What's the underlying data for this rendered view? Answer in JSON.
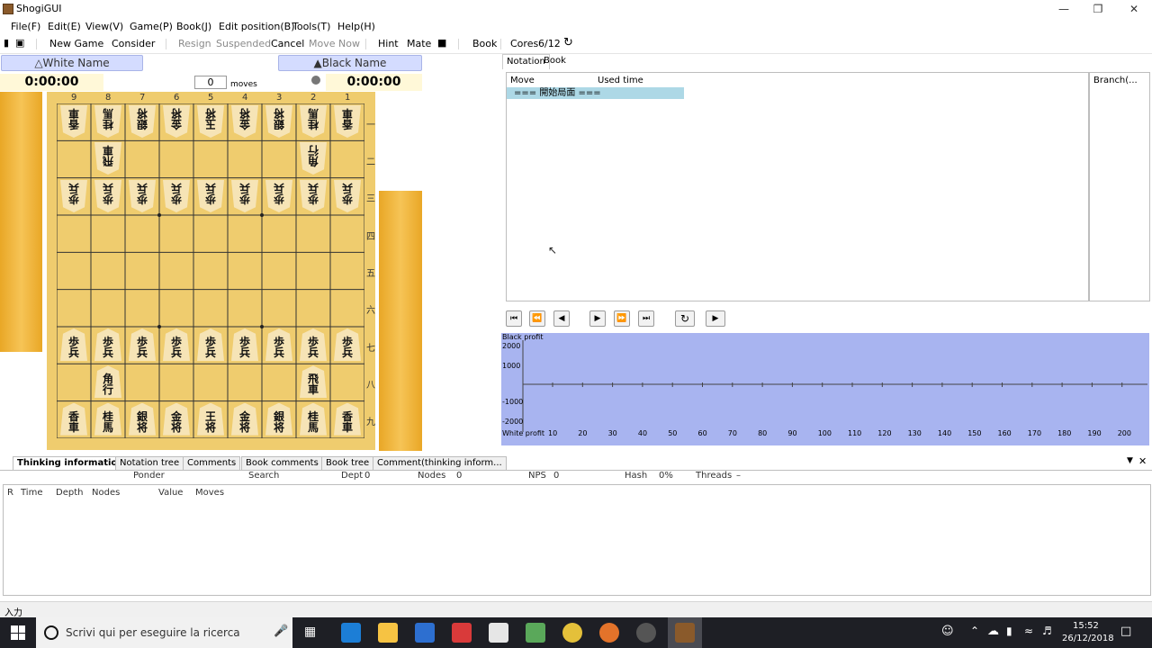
{
  "window": {
    "title": "ShogiGUI"
  },
  "menu": [
    "File(F)",
    "Edit(E)",
    "View(V)",
    "Game(P)",
    "Book(J)",
    "Edit position(B)",
    "Tools(T)",
    "Help(H)"
  ],
  "toolbar": {
    "new_game": "New Game",
    "consider": "Consider",
    "resign": "Resign",
    "suspended": "Suspended",
    "cancel": "Cancel",
    "move_now": "Move Now",
    "hint": "Hint",
    "mate": "Mate",
    "book": "Book",
    "cores_label": "Cores",
    "cores_value": "6/12"
  },
  "players": {
    "white_name": "△White Name",
    "black_name": "▲Black Name",
    "white_time": "0:00:00",
    "black_time": "0:00:00",
    "moves_value": "0",
    "moves_label": "moves"
  },
  "board": {
    "files": [
      "9",
      "8",
      "7",
      "6",
      "5",
      "4",
      "3",
      "2",
      "1"
    ],
    "ranks": [
      "一",
      "二",
      "三",
      "四",
      "五",
      "六",
      "七",
      "八",
      "九"
    ]
  },
  "notation": {
    "tabs": [
      "Notation",
      "Book"
    ],
    "col_move": "Move",
    "col_time": "Used time",
    "start_row": "=== 開始局面 ===",
    "branch_header": "Branch(..."
  },
  "graph": {
    "top_label": "Black profit",
    "bottom_label": "White profit",
    "y_ticks": [
      "2000",
      "1000",
      "-1000",
      "-2000"
    ],
    "x_ticks": [
      "10",
      "20",
      "30",
      "40",
      "50",
      "60",
      "70",
      "80",
      "90",
      "100",
      "110",
      "120",
      "130",
      "140",
      "150",
      "160",
      "170",
      "180",
      "190",
      "200"
    ]
  },
  "bottom_tabs": [
    "Thinking information",
    "Notation tree",
    "Comments",
    "Book comments",
    "Book tree",
    "Comment(thinking inform..."
  ],
  "thinking": {
    "ponder": "Ponder",
    "search": "Search",
    "depth": "Dept",
    "depth_v": "0",
    "nodes": "Nodes",
    "nodes_v": "0",
    "nps": "NPS",
    "nps_v": "0",
    "hash": "Hash",
    "hash_v": "0%",
    "threads": "Threads",
    "threads_v": "–",
    "cols": [
      "R",
      "Time",
      "Depth",
      "Nodes",
      "Value",
      "Moves"
    ]
  },
  "status": {
    "input": "入力"
  },
  "taskbar": {
    "search_placeholder": "Scrivi qui per eseguire la ricerca",
    "time": "15:52",
    "date": "26/12/2018"
  },
  "colors": {
    "graph_bg": "#a8b4f0",
    "name_bg": "#d4dcff",
    "board": "#efcc6e",
    "stand": "#f2b944",
    "notation_highlight": "#add8e6",
    "taskbar": "#1e1f25"
  }
}
